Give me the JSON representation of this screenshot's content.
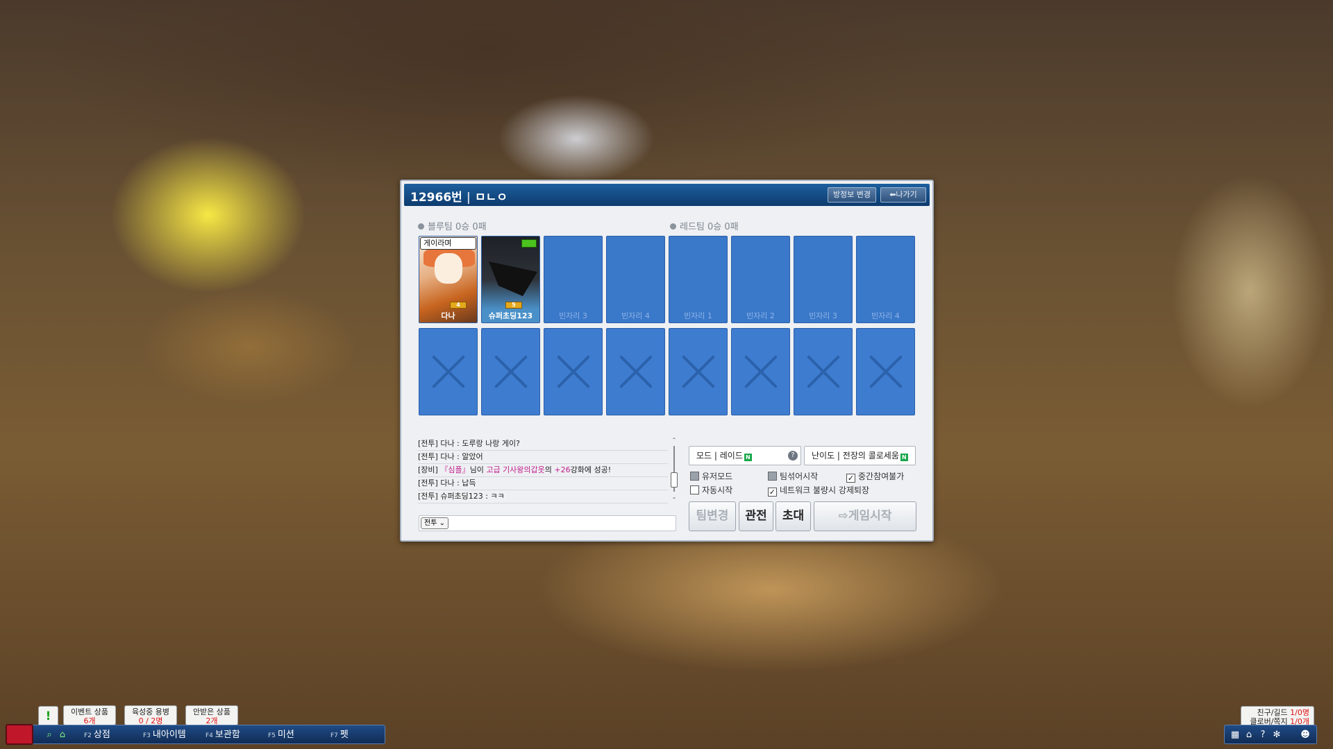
{
  "room": {
    "number": "12966번",
    "name": "ㅁㄴㅇ",
    "btn_change_info": "방정보 변경",
    "btn_exit": "⬅나가기"
  },
  "teams": {
    "blue": "블루팀 0승 0패",
    "red": "레드팀 0승 0패"
  },
  "slots": [
    {
      "label": "다나",
      "bubble": "게이라며",
      "badge": "4"
    },
    {
      "label": "슈퍼초딩123",
      "badge": "5"
    },
    {
      "label": "빈자리 3"
    },
    {
      "label": "빈자리 4"
    },
    {
      "label": "빈자리 1"
    },
    {
      "label": "빈자리 2"
    },
    {
      "label": "빈자리 3"
    },
    {
      "label": "빈자리 4"
    }
  ],
  "chat": {
    "lines": [
      "[전투] 다나 : 도루랑 나랑 게이?",
      "[전투] 다나 : 알았어",
      "[전투] 다나 : 납득",
      "[전투] 슈퍼초딩123 : ㅋㅋ"
    ],
    "equip": {
      "prefix": "[장비] ",
      "name": "『심플』",
      "mid": "님이 ",
      "item": "고급 기사왕의갑옷",
      "mid2": "의 ",
      "level": "+26",
      "suffix": "강화에 성공!"
    },
    "channel": "전투",
    "scroll_arrow_up": "⌃",
    "scroll_arrow_down": "⌄"
  },
  "options": {
    "mode": "모드 | 레이드",
    "difficulty": "난이도 | 전장의 콜로세움",
    "n_badge": "N",
    "help": "?",
    "user_mode": "유저모드",
    "team_shuffle_start": "팀섞어시작",
    "no_midjoin": "중간참여불가",
    "auto_start": "자동시작",
    "network_kick": "네트워크 불량시 강제퇴장",
    "checkmark": "✓"
  },
  "buttons": {
    "team_change": "팀변경",
    "spectate": "관전",
    "invite": "초대",
    "start": "게임시작"
  },
  "notifications": {
    "alert": "!",
    "event": {
      "label": "이벤트 상품",
      "count": "6개"
    },
    "merc": {
      "label": "육성중 용병",
      "count": "0 / 2명"
    },
    "unclaimed": {
      "label": "안받은 상품",
      "count": "2개"
    }
  },
  "taskbar": [
    {
      "key": "F2",
      "label": "상점"
    },
    {
      "key": "F3",
      "label": "내아이템"
    },
    {
      "key": "F4",
      "label": "보관함"
    },
    {
      "key": "F5",
      "label": "미션"
    },
    {
      "key": "F7",
      "label": "펫"
    }
  ],
  "friends": {
    "line1_label": "친구/길드 ",
    "line1_count": "1/0명",
    "line2_label": "클로버/쪽지 ",
    "line2_count": "1/0개"
  },
  "icons": {
    "search": "search-icon",
    "gift": "gift-icon",
    "calendar": "calendar-icon",
    "home": "home-icon",
    "help": "help-icon",
    "settings": "gear-icon",
    "people": "people-icon",
    "exit": "exit-icon"
  },
  "colors": {
    "title_bar": "#0d3b6e",
    "slot_blue": "#3a78c9",
    "pink_text": "#c21a8a",
    "n_badge": "#19a84a",
    "count_red": "#d11111"
  }
}
